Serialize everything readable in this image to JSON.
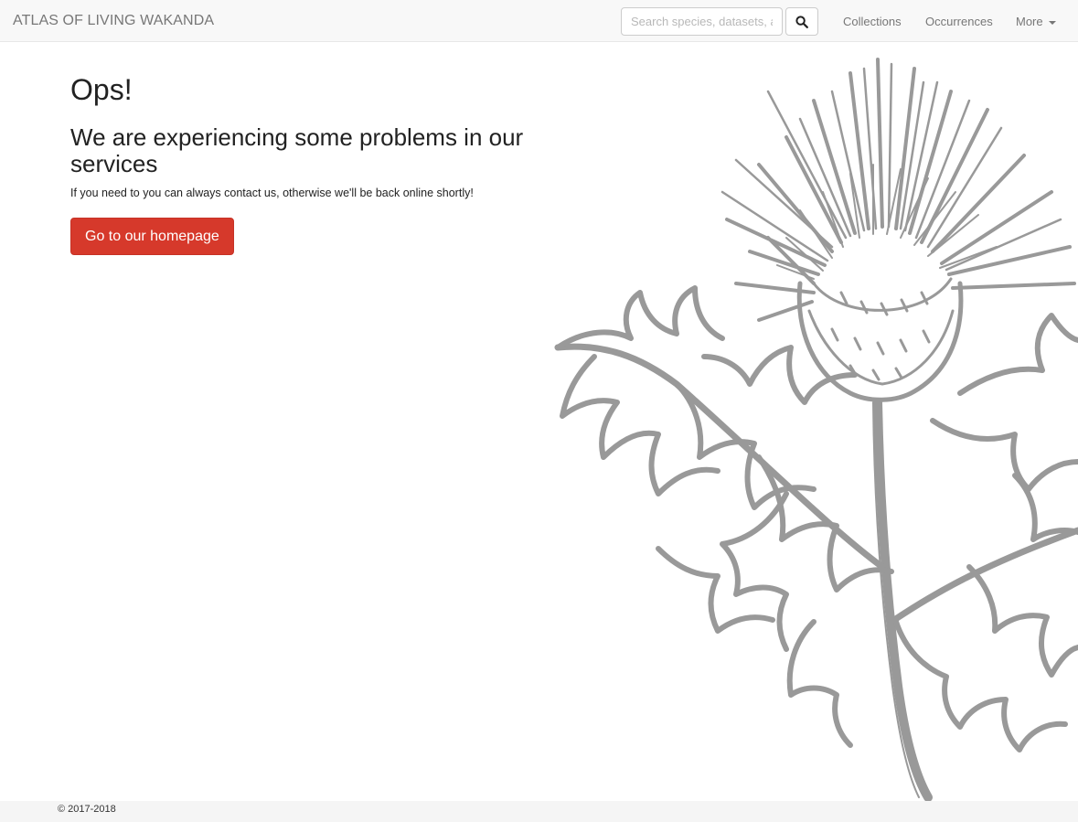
{
  "navbar": {
    "brand": "ATLAS OF LIVING WAKANDA",
    "search_placeholder": "Search species, datasets, a",
    "search_button_icon": "search-icon",
    "links": {
      "collections": "Collections",
      "occurrences": "Occurrences",
      "more": "More"
    },
    "more_icon": "caret-down-icon"
  },
  "main": {
    "title": "Ops!",
    "subtitle": "We are experiencing some problems in our services",
    "message": "If you need to you can always contact us, otherwise we'll be back online shortly!",
    "home_button": "Go to our homepage",
    "illustration": "thistle-illustration"
  },
  "footer": {
    "copyright": "© 2017-2018"
  },
  "colors": {
    "primary_button": "#d6392b",
    "navbar_bg": "#f8f8f8",
    "illustration_stroke": "#999999"
  }
}
